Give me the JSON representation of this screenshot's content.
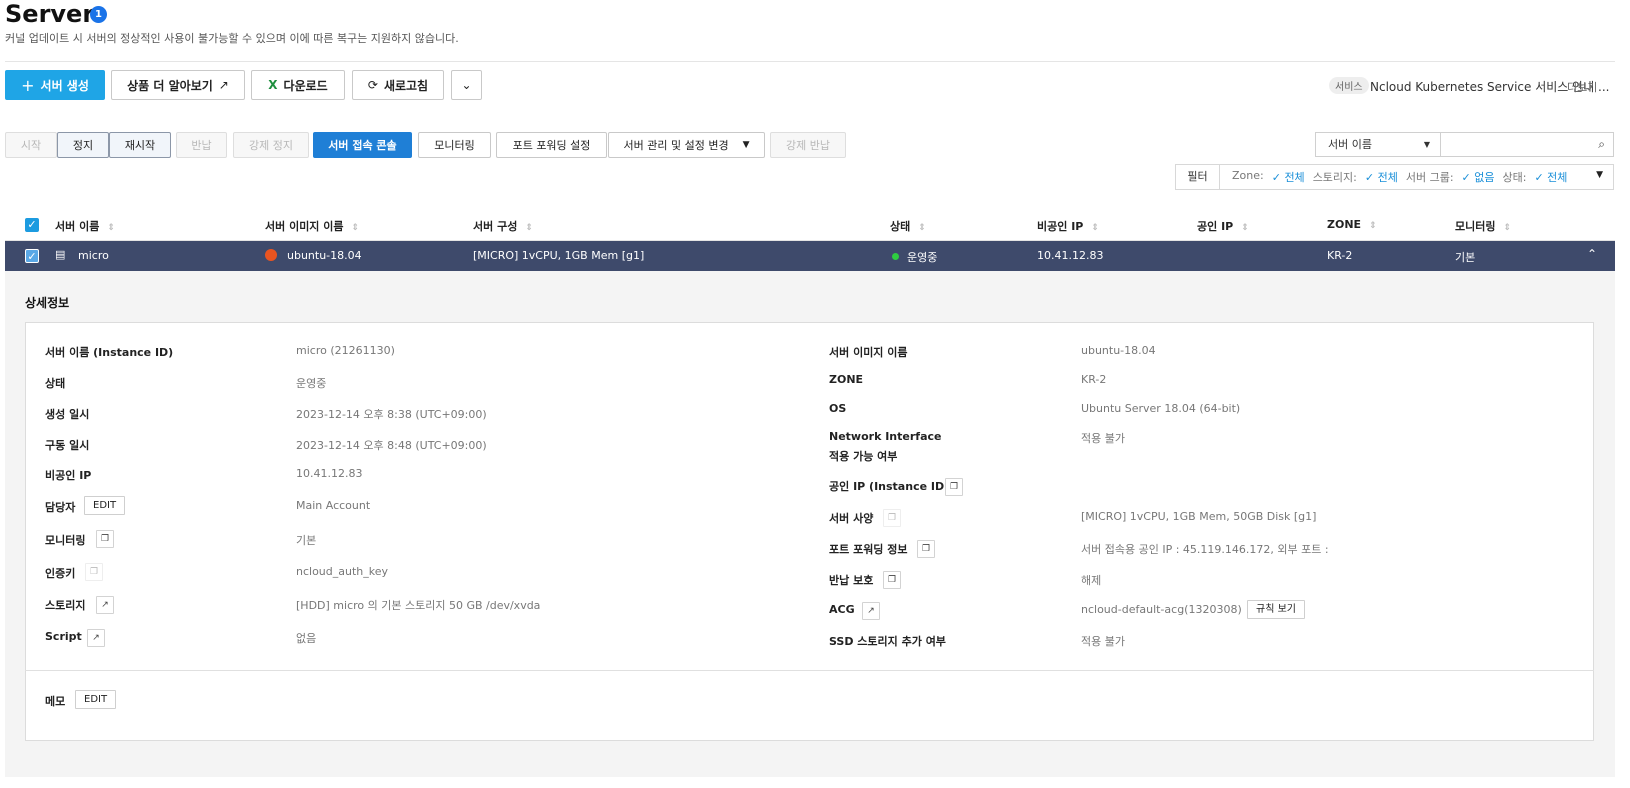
{
  "header": {
    "title": "Server",
    "badge": "1",
    "subtitle": "커널 업데이트 시 서버의 정상적인 사용이 불가능할 수 있으며 이에 따른 복구는 지원하지 않습니다."
  },
  "toolbar": {
    "create_label": "서버 생성",
    "learn_more_label": "상품 더 알아보기",
    "download_label": "다운로드",
    "refresh_label": "새로고침"
  },
  "service_notice": {
    "tag": "서비스",
    "text": "Ncloud Kubernetes Service 서비스 안내 ...",
    "more": "더보기"
  },
  "actions": {
    "start": "시작",
    "stop": "정지",
    "restart": "재시작",
    "return": "반납",
    "force_stop": "강제 정지",
    "console": "서버 접속 콘솔",
    "monitoring": "모니터링",
    "port_forwarding": "포트 포워딩 설정",
    "manage": "서버 관리 및 설정 변경",
    "force_return": "강제 반납"
  },
  "search": {
    "select_value": "서버 이름"
  },
  "filter": {
    "label": "필터",
    "zone_label": "Zone:",
    "zone_value": "전체",
    "storage_label": "스토리지:",
    "storage_value": "전체",
    "group_label": "서버 그룹:",
    "group_value": "없음",
    "status_label": "상태:",
    "status_value": "전체"
  },
  "table": {
    "columns": [
      "서버 이름",
      "서버 이미지 이름",
      "서버 구성",
      "상태",
      "비공인 IP",
      "공인 IP",
      "ZONE",
      "모니터링"
    ],
    "row": {
      "name": "micro",
      "image": "ubuntu-18.04",
      "spec": "[MICRO] 1vCPU, 1GB Mem [g1]",
      "status": "운영중",
      "private_ip": "10.41.12.83",
      "public_ip": "",
      "zone": "KR-2",
      "monitoring": "기본"
    }
  },
  "detail": {
    "title": "상세정보",
    "left": [
      {
        "label": "서버 이름 (Instance ID)",
        "value": "micro (21261130)"
      },
      {
        "label": "상태",
        "value": "운영중"
      },
      {
        "label": "생성 일시",
        "value": "2023-12-14 오후 8:38 (UTC+09:00)"
      },
      {
        "label": "구동 일시",
        "value": "2023-12-14 오후 8:48 (UTC+09:00)"
      },
      {
        "label": "비공인 IP",
        "value": "10.41.12.83"
      },
      {
        "label": "담당자",
        "value": "Main Account"
      },
      {
        "label": "모니터링",
        "value": "기본"
      },
      {
        "label": "인증키",
        "value": "ncloud_auth_key"
      },
      {
        "label": "스토리지",
        "value": "[HDD] micro 의 기본 스토리지  50 GB /dev/xvda"
      },
      {
        "label": "Script",
        "value": "없음"
      }
    ],
    "right": [
      {
        "label": "서버 이미지 이름",
        "value": "ubuntu-18.04"
      },
      {
        "label": "ZONE",
        "value": "KR-2"
      },
      {
        "label": "OS",
        "value": "Ubuntu Server 18.04 (64-bit)"
      },
      {
        "label": "Network Interface",
        "label2": "적용 가능 여부",
        "value": "적용 불가"
      },
      {
        "label": "공인 IP (Instance ID)",
        "value": ""
      },
      {
        "label": "서버 사양",
        "value": "[MICRO] 1vCPU, 1GB Mem, 50GB Disk [g1]"
      },
      {
        "label": "포트 포워딩 정보",
        "value": "서버 접속용 공인 IP : 45.119.146.172, 외부 포트 :"
      },
      {
        "label": "반납 보호",
        "value": "해제"
      },
      {
        "label": "ACG",
        "value": "ncloud-default-acg(1320308)"
      },
      {
        "label": "SSD 스토리지 추가 여부",
        "value": "적용 불가"
      }
    ],
    "edit_label": "EDIT",
    "rules_label": "규칙 보기",
    "memo_label": "메모"
  },
  "colors": {
    "primary": "#1fa5e6",
    "active": "#1f7fd6",
    "selected_row": "#3e4a6b",
    "status_green": "#2ecc40"
  }
}
